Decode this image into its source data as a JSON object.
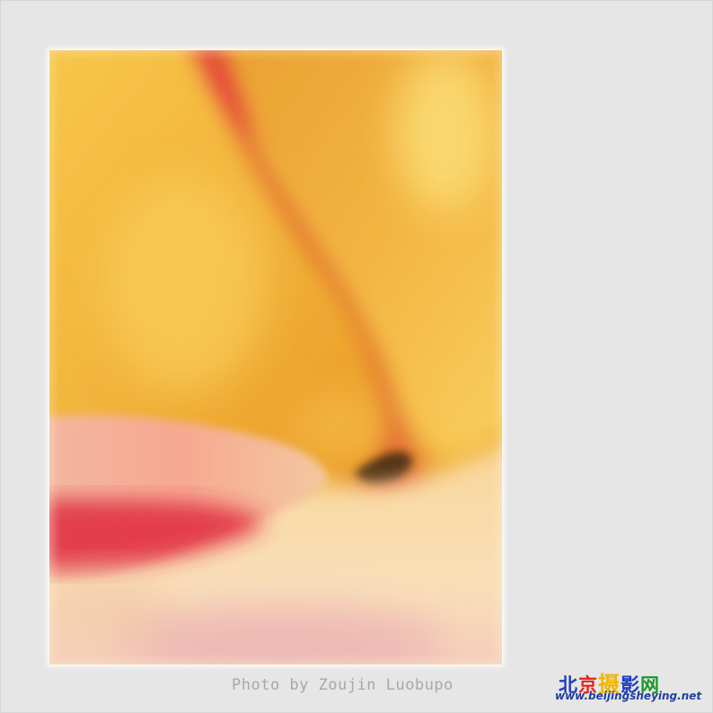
{
  "credit": "Photo by Zoujin Luobupo",
  "logo": {
    "chars": [
      {
        "text": "北",
        "color": "#1f3fbf"
      },
      {
        "text": "京",
        "color": "#e2261e"
      },
      {
        "text": "摄",
        "color": "#f2b400"
      },
      {
        "text": "影",
        "color": "#1f3fbf"
      },
      {
        "text": "网",
        "color": "#1a9a2a"
      }
    ],
    "url": "www.beijingsheying.net"
  },
  "colors": {
    "background": "#e6e6e6",
    "petal_yellow": "#f3c24a",
    "petal_orange": "#e9941f",
    "petal_red": "#d8243a",
    "petal_pink": "#f06a7a",
    "petal_cream": "#fbe2b8"
  }
}
